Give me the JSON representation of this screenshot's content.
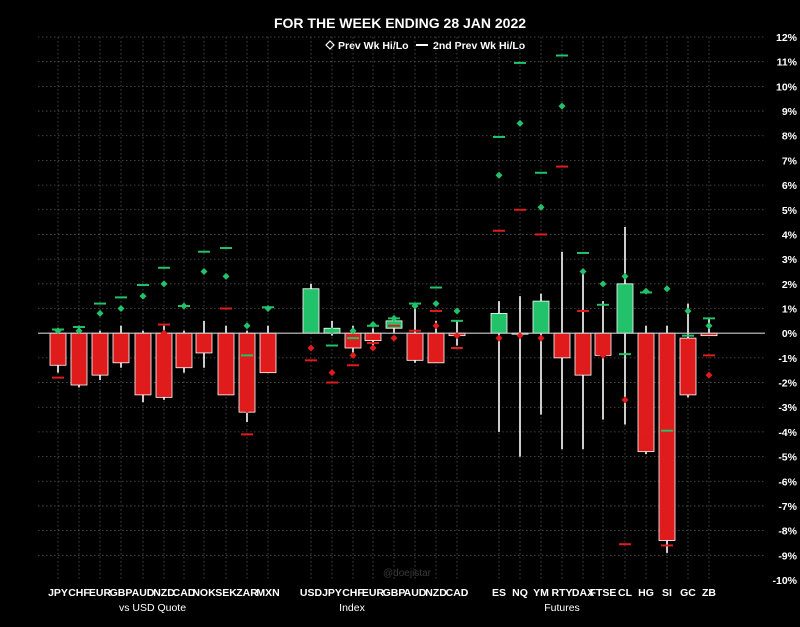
{
  "chart_data": {
    "type": "bar",
    "title": "FOR THE WEEK ENDING 28 JAN 2022",
    "watermark": "@doejistar",
    "legend": {
      "placement": "top-center",
      "entries": [
        {
          "marker": "diamond-outline",
          "label": "Prev Wk Hi/Lo"
        },
        {
          "marker": "dash",
          "label": "2nd Prev Wk Hi/Lo"
        }
      ]
    },
    "ylim": [
      -10,
      12
    ],
    "ytick_step": 1,
    "ytick_suffix": "%",
    "grid": true,
    "colors": {
      "up": "#22c26b",
      "down": "#e01b1b",
      "wick": "#ffffff",
      "zero": "#cccccc",
      "grid": "#555555"
    },
    "groups": [
      {
        "label": "vs USD Quote",
        "start": 0,
        "end": 9
      },
      {
        "label": "Index",
        "start": 10,
        "end": 17
      },
      {
        "label": "Futures",
        "start": 18,
        "end": 27
      }
    ],
    "categories": [
      "JPY",
      "CHF",
      "EUR",
      "GBP",
      "AUD",
      "NZD",
      "CAD",
      "NOK",
      "SEK",
      "ZAR",
      "MXN",
      "USD",
      "JPY",
      "CHF",
      "EUR",
      "GBP",
      "AUD",
      "NZD",
      "CAD",
      "ES",
      "NQ",
      "YM",
      "RTY",
      "DAX",
      "FTSE",
      "CL",
      "HG",
      "SI",
      "GC",
      "ZB"
    ],
    "series": [
      {
        "key": "JPY",
        "open": 0,
        "close": -1.3,
        "high": 0.2,
        "low": -1.6,
        "prev_hi": 0.1,
        "prev_lo": -1.1,
        "prev2_hi": 0.15,
        "prev2_lo": -1.8
      },
      {
        "key": "CHF",
        "open": 0,
        "close": -2.1,
        "high": 0.3,
        "low": -2.2,
        "prev_hi": 0.1,
        "prev_lo": -0.7,
        "prev2_hi": 0.25,
        "prev2_lo": -1.7
      },
      {
        "key": "EUR",
        "open": 0,
        "close": -1.7,
        "high": 0.1,
        "low": -1.9,
        "prev_hi": 0.8,
        "prev_lo": -0.4,
        "prev2_hi": 1.2,
        "prev2_lo": -0.5
      },
      {
        "key": "GBP",
        "open": 0,
        "close": -1.2,
        "high": 0.3,
        "low": -1.4,
        "prev_hi": 1.0,
        "prev_lo": -0.3,
        "prev2_hi": 1.45,
        "prev2_lo": -0.2
      },
      {
        "key": "AUD",
        "open": 0,
        "close": -2.5,
        "high": 0.1,
        "low": -2.8,
        "prev_hi": 1.5,
        "prev_lo": -0.3,
        "prev2_hi": 1.95,
        "prev2_lo": -0.35
      },
      {
        "key": "NZD",
        "open": 0,
        "close": -2.6,
        "high": 0.3,
        "low": -2.7,
        "prev_hi": 2.0,
        "prev_lo": 0.0,
        "prev2_hi": 2.65,
        "prev2_lo": 0.35
      },
      {
        "key": "CAD",
        "open": 0,
        "close": -1.4,
        "high": 0.1,
        "low": -1.6,
        "prev_hi": 1.1,
        "prev_lo": -0.8,
        "prev2_hi": 1.1,
        "prev2_lo": -0.85
      },
      {
        "key": "NOK",
        "open": 0,
        "close": -0.8,
        "high": 0.5,
        "low": -1.4,
        "prev_hi": 2.5,
        "prev_lo": -0.5,
        "prev2_hi": 3.3,
        "prev2_lo": -0.7
      },
      {
        "key": "SEK",
        "open": 0,
        "close": -2.5,
        "high": 0.3,
        "low": -2.5,
        "prev_hi": 2.3,
        "prev_lo": -0.2,
        "prev2_hi": 3.45,
        "prev2_lo": 1.0
      },
      {
        "key": "ZAR",
        "open": 0,
        "close": -3.2,
        "high": 0.1,
        "low": -3.6,
        "prev_hi": 0.3,
        "prev_lo": -3.1,
        "prev2_hi": -0.9,
        "prev2_lo": -4.1
      },
      {
        "key": "MXN",
        "open": 0,
        "close": -1.6,
        "high": 0.3,
        "low": -1.6,
        "prev_hi": 1.0,
        "prev_lo": -0.3,
        "prev2_hi": 1.05,
        "prev2_lo": -0.4
      },
      {
        "key": "USD",
        "open": 0,
        "close": 1.8,
        "high": 2.0,
        "low": 0.0,
        "prev_hi": 0.2,
        "prev_lo": -0.6,
        "prev2_hi": 0.6,
        "prev2_lo": -1.1
      },
      {
        "key": "JPY",
        "open": 0,
        "close": 0.2,
        "high": 0.5,
        "low": -0.1,
        "prev_hi": 0.1,
        "prev_lo": -1.6,
        "prev2_hi": -0.5,
        "prev2_lo": -2.0
      },
      {
        "key": "CHF",
        "open": 0,
        "close": -0.6,
        "high": 0.3,
        "low": -0.8,
        "prev_hi": 0.1,
        "prev_lo": -0.9,
        "prev2_hi": -0.2,
        "prev2_lo": -1.3
      },
      {
        "key": "EUR",
        "open": 0,
        "close": -0.3,
        "high": 0.2,
        "low": -0.5,
        "prev_hi": 0.35,
        "prev_lo": -0.6,
        "prev2_hi": 0.3,
        "prev2_lo": -0.4
      },
      {
        "key": "GBP",
        "open": 0.2,
        "close": 0.5,
        "high": 0.6,
        "low": 0.0,
        "prev_hi": 0.6,
        "prev_lo": -0.2,
        "prev2_hi": 0.6,
        "prev2_lo": 0.3
      },
      {
        "key": "AUD",
        "open": 0,
        "close": -1.1,
        "high": 1.1,
        "low": -1.2,
        "prev_hi": 1.1,
        "prev_lo": -0.2,
        "prev2_hi": 1.2,
        "prev2_lo": 0.1
      },
      {
        "key": "NZD",
        "open": 0,
        "close": -1.2,
        "high": 0.5,
        "low": -1.2,
        "prev_hi": 1.2,
        "prev_lo": 0.3,
        "prev2_hi": 1.85,
        "prev2_lo": 0.9
      },
      {
        "key": "CAD",
        "open": 0,
        "close": -0.1,
        "high": 0.5,
        "low": -0.5,
        "prev_hi": 0.9,
        "prev_lo": -0.1,
        "prev2_hi": 0.5,
        "prev2_lo": -0.6
      },
      {
        "key": "ES",
        "open": 0,
        "close": 0.8,
        "high": 1.3,
        "low": -4.0,
        "prev_hi": 6.4,
        "prev_lo": -0.2,
        "prev2_hi": 7.95,
        "prev2_lo": 4.15
      },
      {
        "key": "NQ",
        "open": 0,
        "close": 0.0,
        "high": 1.5,
        "low": -5.0,
        "prev_hi": 8.5,
        "prev_lo": -0.1,
        "prev2_hi": 10.95,
        "prev2_lo": 5.0
      },
      {
        "key": "YM",
        "open": 0,
        "close": 1.3,
        "high": 1.6,
        "low": -3.3,
        "prev_hi": 5.1,
        "prev_lo": -0.2,
        "prev2_hi": 6.5,
        "prev2_lo": 4.0
      },
      {
        "key": "RTY",
        "open": 0,
        "close": -1.0,
        "high": 3.3,
        "low": -4.7,
        "prev_hi": 9.2,
        "prev_lo": -0.2,
        "prev2_hi": 11.25,
        "prev2_lo": 6.75
      },
      {
        "key": "DAX",
        "open": 0,
        "close": -1.7,
        "high": 2.6,
        "low": -4.7,
        "prev_hi": 2.5,
        "prev_lo": -0.9,
        "prev2_hi": 3.25,
        "prev2_lo": 0.9
      },
      {
        "key": "FTSE",
        "open": 0,
        "close": -0.9,
        "high": 1.3,
        "low": -3.5,
        "prev_hi": 2.0,
        "prev_lo": -0.9,
        "prev2_hi": 1.15,
        "prev2_lo": -0.85
      },
      {
        "key": "CL",
        "open": 0,
        "close": 2.0,
        "high": 4.3,
        "low": -3.7,
        "prev_hi": 2.3,
        "prev_lo": -2.7,
        "prev2_hi": -0.85,
        "prev2_lo": -8.55
      },
      {
        "key": "HG",
        "open": 0,
        "close": -4.8,
        "high": 0.3,
        "low": -4.9,
        "prev_hi": 1.7,
        "prev_lo": -3.3,
        "prev2_hi": 1.65,
        "prev2_lo": -4.25
      },
      {
        "key": "SI",
        "open": 0,
        "close": -8.4,
        "high": 0.3,
        "low": -8.9,
        "prev_hi": 1.8,
        "prev_lo": -6.2,
        "prev2_hi": -3.95,
        "prev2_lo": -8.6
      },
      {
        "key": "GC",
        "open": -0.2,
        "close": -2.5,
        "high": 1.2,
        "low": -2.6,
        "prev_hi": 0.9,
        "prev_lo": -1.4,
        "prev2_hi": -0.1,
        "prev2_lo": -2.3
      },
      {
        "key": "ZB",
        "open": 0,
        "close": -0.1,
        "high": 0.6,
        "low": -0.1,
        "prev_hi": 0.3,
        "prev_lo": -1.7,
        "prev2_hi": 0.6,
        "prev2_lo": -0.9
      }
    ]
  }
}
